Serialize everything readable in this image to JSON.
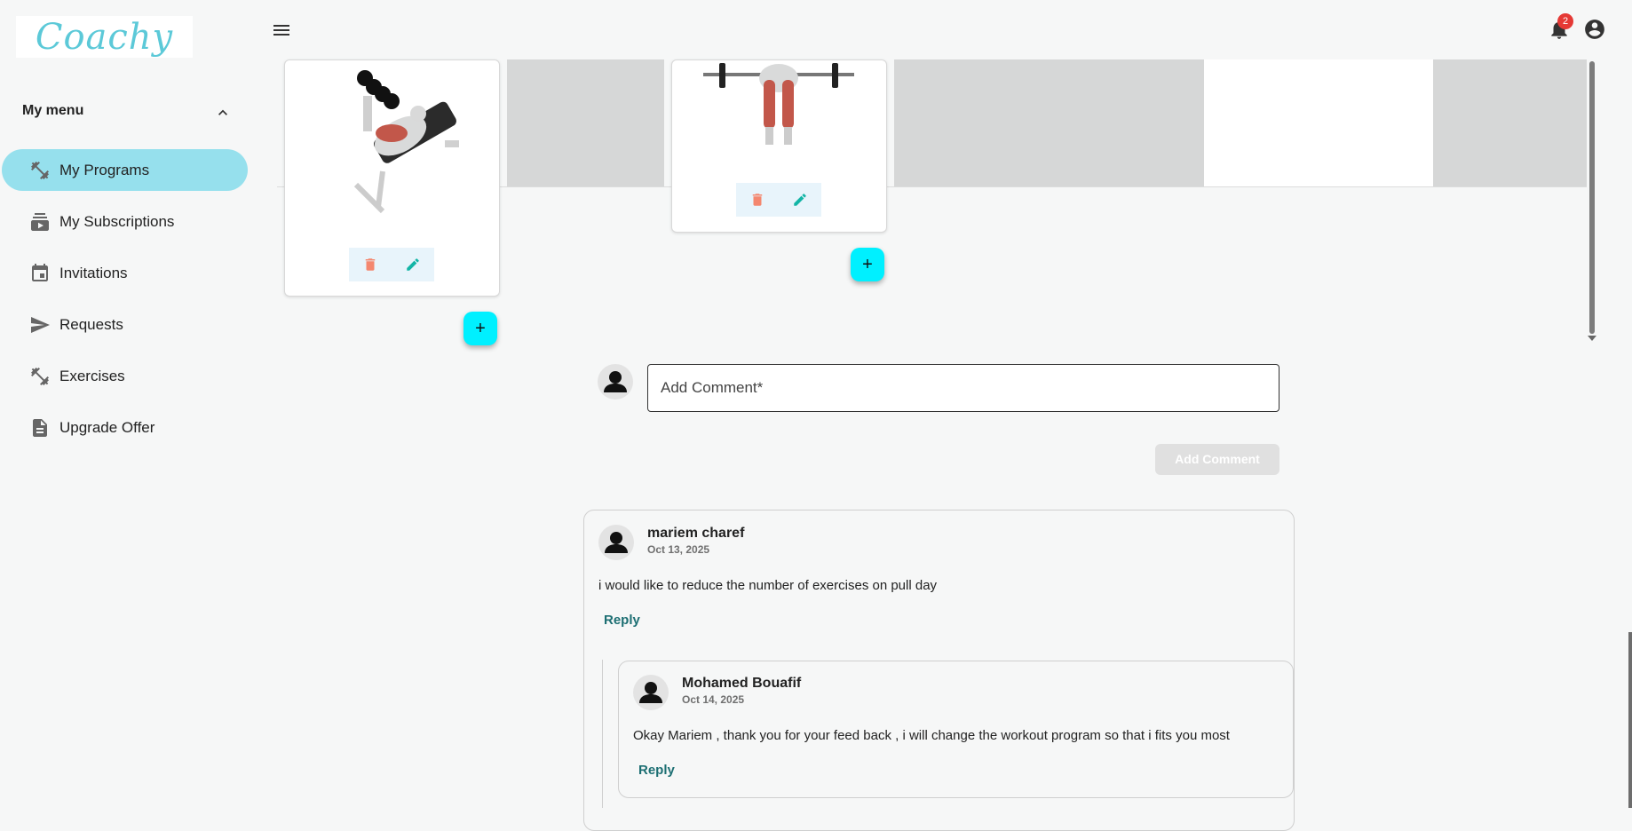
{
  "header": {
    "logo_text": "Coachy",
    "notification_count": "2",
    "icons": [
      "menu-icon",
      "bell-icon",
      "account-circle-icon"
    ]
  },
  "sidebar": {
    "title": "My menu",
    "items": [
      {
        "label": "My Programs",
        "icon": "dumbbell-icon",
        "active": true
      },
      {
        "label": "My Subscriptions",
        "icon": "subscriptions-icon",
        "active": false
      },
      {
        "label": "Invitations",
        "icon": "calendar-icon",
        "active": false
      },
      {
        "label": "Requests",
        "icon": "send-icon",
        "active": false
      },
      {
        "label": "Exercises",
        "icon": "dumbbell-icon",
        "active": false
      },
      {
        "label": "Upgrade Offer",
        "icon": "document-icon",
        "active": false
      }
    ]
  },
  "program": {
    "add_button_label": "+"
  },
  "comment_form": {
    "placeholder": "Add Comment*",
    "submit_label": "Add Comment"
  },
  "comments": [
    {
      "author": "mariem charef",
      "date": "Oct 13, 2025",
      "text": "i would like to reduce the number of exercises on pull day",
      "reply_label": "Reply"
    },
    {
      "author": "Mohamed Bouafif",
      "date": "Oct 14, 2025",
      "text": "Okay Mariem , thank you for your feed back , i will change the workout program so that i fits you most",
      "reply_label": "Reply"
    }
  ],
  "colors": {
    "accent": "#96e0ed",
    "fab": "#00f0ff",
    "delete": "#f4876f",
    "edit": "#13b5a6",
    "reply": "#1d6f73"
  }
}
